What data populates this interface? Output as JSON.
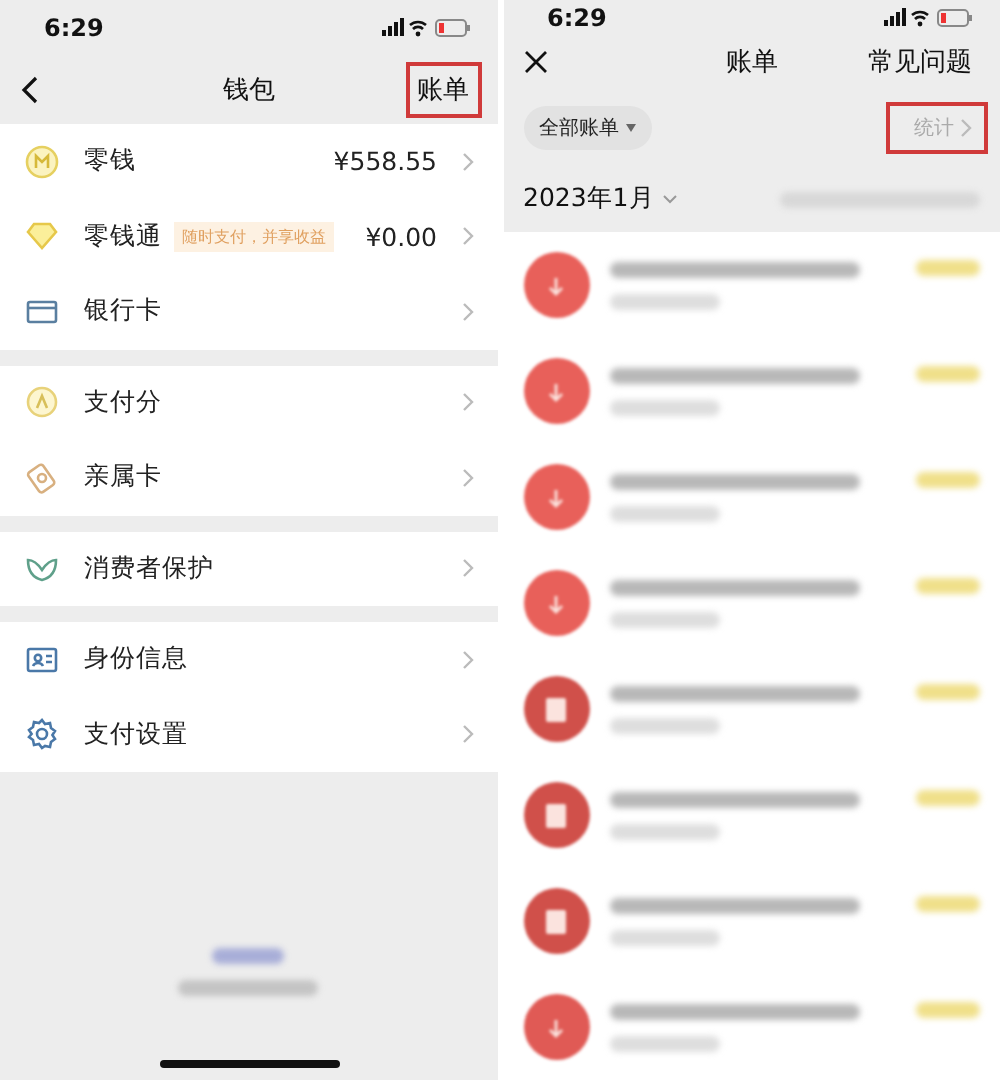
{
  "wallet": {
    "status_bar": {
      "time": "6:29"
    },
    "header": {
      "title": "钱包",
      "action": "账单",
      "action_highlighted": true
    },
    "groups": [
      {
        "items": [
          {
            "kind": "coin",
            "label": "零钱",
            "value": "¥558.55"
          },
          {
            "kind": "diamond",
            "label": "零钱通",
            "badge": "随时支付，并享收益",
            "value": "¥0.00"
          },
          {
            "kind": "card",
            "label": "银行卡"
          }
        ]
      },
      {
        "items": [
          {
            "kind": "score",
            "label": "支付分"
          },
          {
            "kind": "family",
            "label": "亲属卡"
          }
        ]
      },
      {
        "items": [
          {
            "kind": "shield",
            "label": "消费者保护"
          }
        ]
      },
      {
        "items": [
          {
            "kind": "id",
            "label": "身份信息"
          },
          {
            "kind": "gear",
            "label": "支付设置"
          }
        ]
      }
    ]
  },
  "bills": {
    "status_bar": {
      "time": "6:29"
    },
    "header": {
      "title": "账单",
      "action": "常见问题"
    },
    "filter": {
      "label": "全部账单",
      "stats": "统计",
      "stats_highlighted": true
    },
    "month": "2023年1月",
    "rows": [
      {
        "kind": "transfer"
      },
      {
        "kind": "transfer"
      },
      {
        "kind": "transfer"
      },
      {
        "kind": "transfer"
      },
      {
        "kind": "red_packet"
      },
      {
        "kind": "red_packet"
      },
      {
        "kind": "red_packet"
      },
      {
        "kind": "other"
      }
    ]
  }
}
